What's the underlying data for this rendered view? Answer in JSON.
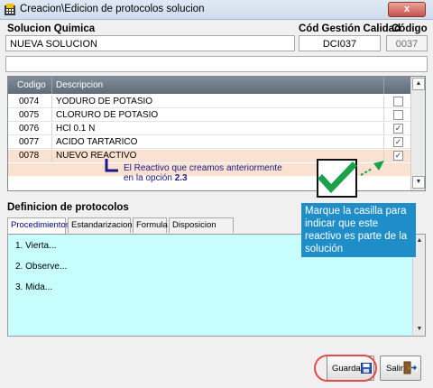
{
  "window": {
    "title": "Creacion\\Edicion de protocolos solucion",
    "close_label": "x"
  },
  "form": {
    "solucion_label": "Solucion Quimica",
    "solucion_value": "NUEVA SOLUCION",
    "cod_gestion_label": "Cód Gestión Calidad",
    "cod_gestion_value": "DCI037",
    "codigo_label": "Código",
    "codigo_value": "0037",
    "extra_value": ""
  },
  "grid": {
    "columns": [
      "Codigo",
      "Descripcion"
    ],
    "rows": [
      {
        "code": "0074",
        "desc": "YODURO DE POTASIO",
        "checked": false
      },
      {
        "code": "0075",
        "desc": "CLORURO DE POTASIO",
        "checked": false
      },
      {
        "code": "0076",
        "desc": "HCl 0.1 N",
        "checked": true
      },
      {
        "code": "0077",
        "desc": "ACIDO TARTARICO",
        "checked": true
      },
      {
        "code": "0078",
        "desc": "NUEVO REACTIVO",
        "checked": true
      }
    ]
  },
  "annotation": {
    "note_line1": "El Reactivo que creamos anteriormente",
    "note_line2_prefix": "en la opción ",
    "note_line2_bold": "2.3",
    "callout": "Marque la casilla para indicar que este reactivo es parte de la solución"
  },
  "protocolos": {
    "heading": "Definicion de protocolos",
    "tabs": [
      "Procedimientos",
      "Estandarizacion",
      "Formula",
      "Disposicion Final"
    ],
    "lines": [
      "1. Vierta...",
      "2. Observe...",
      "3. Mida..."
    ]
  },
  "buttons": {
    "guardar": "Guardar",
    "salir": "Salir"
  },
  "colors": {
    "highlight_row": "#fbe1cf",
    "callout_bg": "#1f8ec8",
    "proc_bg": "#c7fdfd",
    "check_green": "#1aa24a",
    "oval_red": "#e34a4a"
  }
}
